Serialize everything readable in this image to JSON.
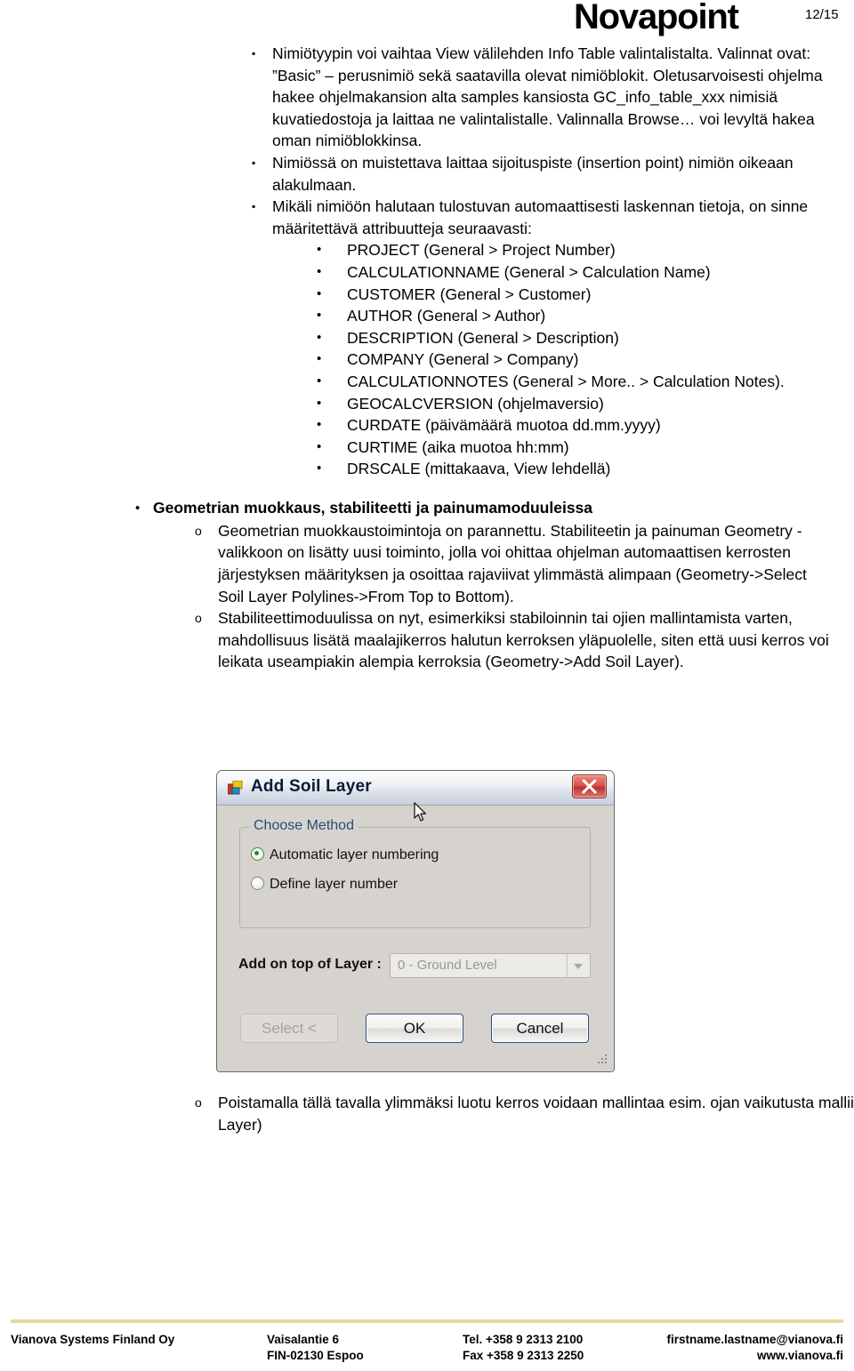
{
  "header": {
    "logo": "Novapoint",
    "page_number": "12/15"
  },
  "content": {
    "bullets": [
      {
        "marker": "▪",
        "text": "Nimiötyypin voi vaihtaa View välilehden Info Table valintalistalta. Valinnat ovat: ”Basic” – perusnimiö sekä saatavilla olevat nimiöblokit. Oletusarvoisesti ohjelma hakee ohjelmakansion alta samples kansiosta GC_info_table_xxx nimisiä kuvatiedostoja ja laittaa ne valintalistalle. Valinnalla Browse… voi levyltä hakea oman nimiöblokkinsa."
      },
      {
        "marker": "▪",
        "text": "Nimiössä on muistettava laittaa sijoituspiste (insertion point) nimiön oikeaan alakulmaan."
      },
      {
        "marker": "▪",
        "text": "Mikäli nimiöön halutaan tulostuvan automaattisesti laskennan tietoja, on sinne määritettävä attribuutteja seuraavasti:"
      }
    ],
    "attributes": {
      "marker": "•",
      "items": [
        "PROJECT (General > Project Number)",
        "CALCULATIONNAME (General > Calculation Name)",
        "CUSTOMER (General > Customer)",
        "AUTHOR (General > Author)",
        "DESCRIPTION (General > Description)",
        "COMPANY (General > Company)",
        "CALCULATIONNOTES (General > More.. > Calculation Notes).",
        "GEOCALCVERSION (ohjelmaversio)",
        "CURDATE (päivämäärä muotoa dd.mm.yyyy)",
        "CURTIME (aika muotoa hh:mm)",
        "DRSCALE (mittakaava, View lehdellä)"
      ]
    },
    "section": {
      "marker": "•",
      "heading": "Geometrian muokkaus, stabiliteetti ja painumamoduuleissa",
      "sub_marker": "o",
      "paragraphs": [
        "Geometrian muokkaustoimintoja on parannettu. Stabiliteetin ja painuman Geometry -valikkoon on lisätty uusi toiminto, jolla voi ohittaa ohjelman automaattisen kerrosten järjestyksen määrityksen ja osoittaa rajaviivat ylimmästä alimpaan (Geometry->Select Soil Layer Polylines->From Top to Bottom).",
        "Stabiliteettimoduulissa on nyt, esimerkiksi stabiloinnin tai ojien mallintamista varten, mahdollisuus lisätä maalajikerros halutun kerroksen yläpuolelle, siten että uusi kerros voi leikata useampiakin alempia kerroksia (Geometry->Add Soil Layer)."
      ],
      "closing_paragraph": "Poistamalla tällä tavalla ylimmäksi luotu kerros voidaan mallintaa esim. ojan vaikutusta malliin (Geometry-> Remove Soil Layer)"
    }
  },
  "dialog": {
    "title": "Add Soil Layer",
    "close_label": "Close",
    "group": {
      "label": "Choose Method",
      "options": [
        {
          "label": "Automatic layer numbering",
          "selected": true
        },
        {
          "label": "Define layer number",
          "selected": false
        }
      ]
    },
    "field": {
      "label": "Add on top of Layer :",
      "value": "0 - Ground Level",
      "disabled": true
    },
    "buttons": [
      {
        "label": "Select <",
        "disabled": true
      },
      {
        "label": "OK",
        "disabled": false
      },
      {
        "label": "Cancel",
        "disabled": false
      }
    ]
  },
  "footer": {
    "company": "Vianova Systems Finland Oy",
    "address_line1": "Vaisalantie 6",
    "address_line2": "FIN-02130 Espoo",
    "tel": "Tel. +358 9 2313 2100",
    "fax": "Fax +358 9 2313 2250",
    "email": "firstname.lastname@vianova.fi",
    "web": "www.vianova.fi",
    "rule_color": "#e8d5a0"
  }
}
